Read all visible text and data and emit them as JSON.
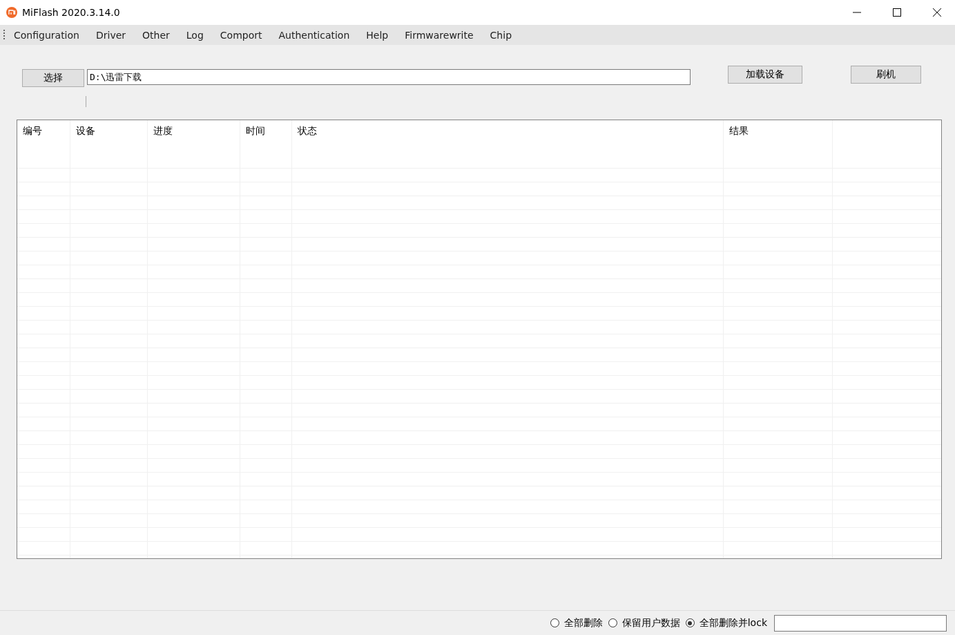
{
  "window": {
    "title": "MiFlash 2020.3.14.0"
  },
  "menu": [
    "Configuration",
    "Driver",
    "Other",
    "Log",
    "Comport",
    "Authentication",
    "Help",
    "Firmwarewrite",
    "Chip"
  ],
  "select_button": "选择",
  "path_field": {
    "value": "D:\\迅雷下载"
  },
  "load_button": "加载设备",
  "flash_button": "刷机",
  "table": {
    "columns": [
      "编号",
      "设备",
      "进度",
      "时间",
      "状态",
      "结果"
    ]
  },
  "options": [
    {
      "label": "全部删除",
      "selected": false
    },
    {
      "label": "保留用户数据",
      "selected": false
    },
    {
      "label": "全部删除并lock",
      "selected": true
    }
  ]
}
